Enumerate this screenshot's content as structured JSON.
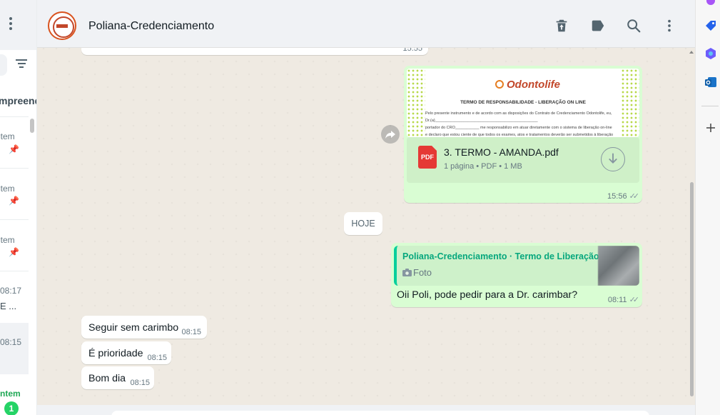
{
  "left_panel": {
    "section_header": "mpreendi",
    "items": [
      {
        "label": "ntem",
        "pinned": true
      },
      {
        "label": "ntem",
        "pinned": true
      },
      {
        "label": "ntem",
        "pinned": true
      },
      {
        "label": "08:17",
        "sub": "E ..."
      },
      {
        "label": "08:15"
      },
      {
        "label": "ntem",
        "unread": "1"
      }
    ]
  },
  "chat": {
    "title": "Poliana-Credenciamento",
    "prev_message_time": "15:55",
    "document_message": {
      "preview_logo": "Odontolife",
      "preview_title": "TERMO DE RESPONSABILIDADE - LIBERAÇÃO ON LINE",
      "preview_lines": [
        "Pelo presente instrumento e de acordo com as disposições do Contrato de Credenciamento Odontolife,  eu,",
        "Dr.(a)_______________________________________________",
        "portador do CRO___________ me responsabilizo em atuar diretamente com o sistema de liberação on-line",
        "e declaro que estou ciente de que todos os exames, atos e tratamentos deverão ser submetidos à liberação"
      ],
      "file_name": "3. TERMO - AMANDA.pdf",
      "file_meta": "1 página • PDF • 1 MB",
      "file_type": "PDF",
      "time": "15:56"
    },
    "date_divider": "HOJE",
    "reply_message": {
      "quote_author": "Poliana-Credenciamento · Termo de Liberação",
      "quote_type": "Foto",
      "text": "Oii Poli, pode pedir para a Dr. carimbar?",
      "time": "08:11"
    },
    "incoming": [
      {
        "text": "Seguir sem carimbo",
        "time": "08:15"
      },
      {
        "text": "É prioridade",
        "time": "08:15"
      },
      {
        "text": "Bom dia",
        "time": "08:15"
      }
    ]
  },
  "colors": {
    "outgoing_bubble": "#d9fdd3",
    "incoming_bubble": "#ffffff",
    "accent_green": "#06cf9c",
    "chat_bg": "#efeae2"
  },
  "icons": {
    "header": [
      "delete-icon",
      "label-icon",
      "search-icon",
      "menu-icon"
    ],
    "edge": [
      "tag-icon",
      "copilot-icon",
      "outlook-icon",
      "add-icon"
    ]
  }
}
